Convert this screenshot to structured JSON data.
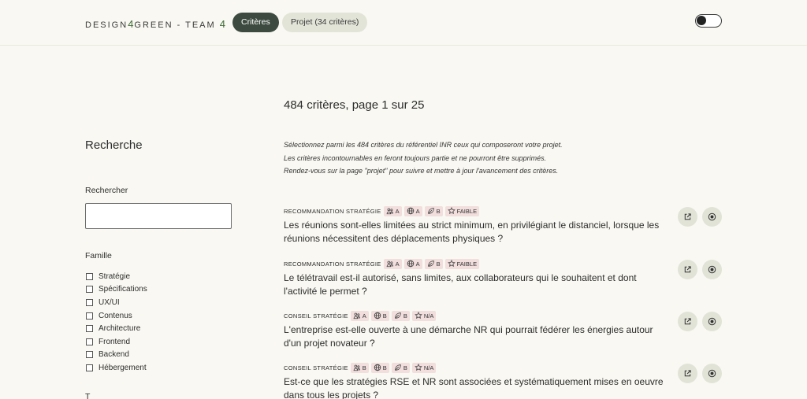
{
  "header": {
    "logo": "DESIGN4GREEN - TEAM 4",
    "logo_prefix": "DESIGN",
    "logo_digit": "4",
    "logo_middle": "GREEN - TEAM ",
    "logo_suffix_digit": "4",
    "tabs": [
      {
        "label": "Critères",
        "active": true
      },
      {
        "label": "Projet (34 critères)",
        "active": false
      }
    ],
    "theme_toggle": {
      "on": false
    }
  },
  "results": {
    "summary": "484 critères, page 1 sur 25"
  },
  "sidebar": {
    "title": "Recherche",
    "search_label": "Rechercher",
    "search_value": "",
    "family_label": "Famille",
    "families": [
      "Stratégie",
      "Spécifications",
      "UX/UI",
      "Contenus",
      "Architecture",
      "Frontend",
      "Backend",
      "Hébergement"
    ],
    "next_section_label": "T"
  },
  "intro": [
    "Sélectionnez parmi les 484 critères du référentiel INR ceux qui composeront votre projet.",
    "Les critères incontournables en feront toujours partie et ne pourront être supprimés.",
    "Rendez-vous sur la page \"projet\" pour suivre et mettre à jour l'avancement des critères."
  ],
  "criteria": [
    {
      "category": "RECOMMANDATION STRATÉGIE",
      "people": "A",
      "planet": "A",
      "prosperity": "B",
      "priority": "FAIBLE",
      "question": "Les réunions sont-elles limitées au strict minimum, en privilégiant le distanciel, lorsque les réunions nécessitent des déplacements physiques ?"
    },
    {
      "category": "RECOMMANDATION STRATÉGIE",
      "people": "A",
      "planet": "A",
      "prosperity": "B",
      "priority": "FAIBLE",
      "question": "Le télétravail est-il autorisé, sans limites, aux collaborateurs qui le souhaitent et dont l'activité le permet ?"
    },
    {
      "category": "CONSEIL STRATÉGIE",
      "people": "A",
      "planet": "B",
      "prosperity": "B",
      "priority": "N/A",
      "question": "L'entreprise est-elle ouverte à une démarche NR qui pourrait fédérer les énergies autour d'un projet novateur ?"
    },
    {
      "category": "CONSEIL STRATÉGIE",
      "people": "B",
      "planet": "B",
      "prosperity": "B",
      "priority": "N/A",
      "question": "Est-ce que les stratégies RSE et NR sont associées et systématiquement mises en oeuvre dans tous les projets ?"
    }
  ],
  "icons": {
    "people": "people-icon",
    "planet": "globe-icon",
    "prosperity": "leaf-icon",
    "priority": "star-icon",
    "open": "external-link-icon",
    "add": "add-circle-icon"
  }
}
